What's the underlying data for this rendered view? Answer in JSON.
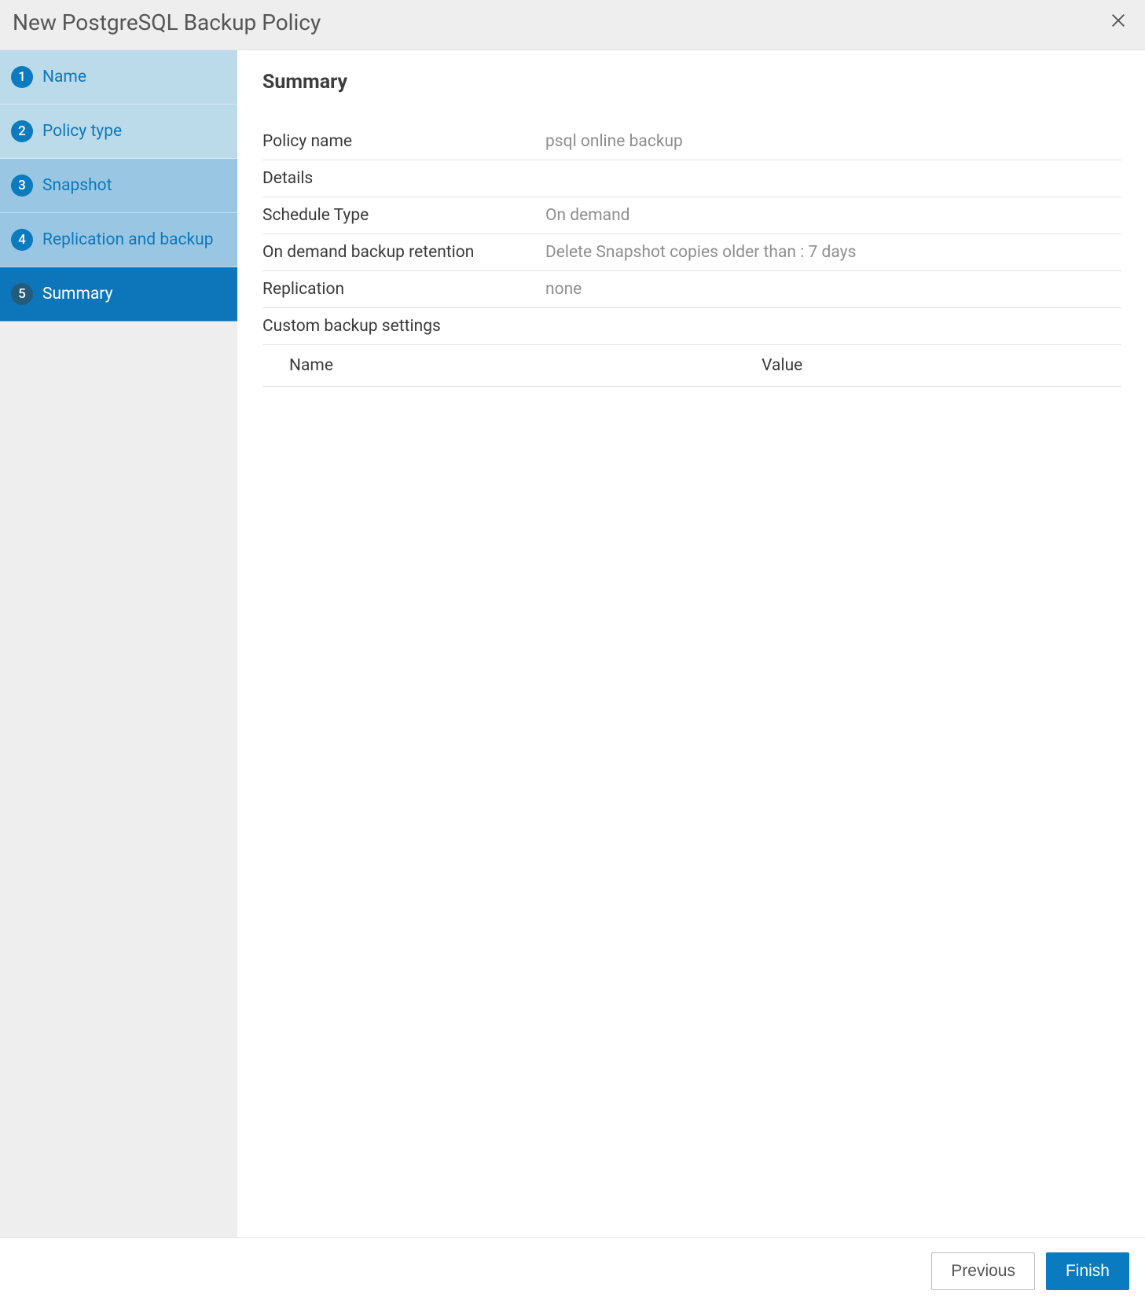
{
  "header": {
    "title": "New PostgreSQL Backup Policy"
  },
  "sidebar": {
    "steps": [
      {
        "num": "1",
        "label": "Name"
      },
      {
        "num": "2",
        "label": "Policy type"
      },
      {
        "num": "3",
        "label": "Snapshot"
      },
      {
        "num": "4",
        "label": "Replication and backup"
      },
      {
        "num": "5",
        "label": "Summary"
      }
    ]
  },
  "main": {
    "title": "Summary",
    "rows": {
      "policy_name_label": "Policy name",
      "policy_name_value": "psql online backup",
      "details_label": "Details",
      "schedule_type_label": "Schedule Type",
      "schedule_type_value": "On demand",
      "retention_label": "On demand backup retention",
      "retention_value": "Delete Snapshot copies older than : 7 days",
      "replication_label": "Replication",
      "replication_value": "none",
      "custom_label": "Custom backup settings"
    },
    "columns": {
      "name": "Name",
      "value": "Value"
    }
  },
  "footer": {
    "previous": "Previous",
    "finish": "Finish"
  }
}
